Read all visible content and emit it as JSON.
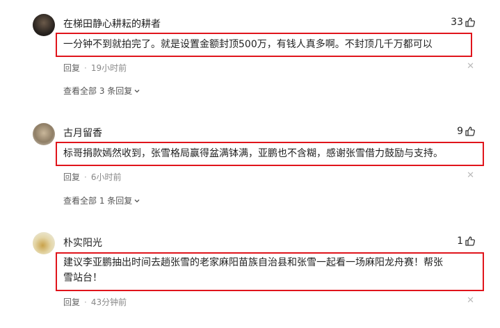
{
  "comments": [
    {
      "username": "在梯田静心耕耘的耕者",
      "likes": "33",
      "content": "一分钟不到就拍完了。就是设置金额封顶500万，有钱人真多啊。不封顶几千万都可以",
      "reply_label": "回复",
      "time": "19小时前",
      "view_replies": "查看全部 3 条回复"
    },
    {
      "username": "古月留香",
      "likes": "9",
      "content": "标哥捐款嫣然收到，张雪格局赢得盆满钵满，亚鹏也不含糊，感谢张雪借力鼓励与支持。",
      "reply_label": "回复",
      "time": "6小时前",
      "view_replies": "查看全部 1 条回复"
    },
    {
      "username": "朴实阳光",
      "likes": "1",
      "content_line1": "建议李亚鹏抽出时间去趟张雪的老家麻阳苗族自治县和张雪一起看一场麻阳龙舟赛！帮张",
      "content_line2": "雪站台！",
      "reply_label": "回复",
      "time": "43分钟前"
    }
  ],
  "icons": {
    "like": "thumbs-up-icon",
    "close": "close-icon",
    "expand": "chevron-down-icon"
  },
  "colors": {
    "highlight_border": "#e0141b",
    "meta_text": "#888888"
  }
}
